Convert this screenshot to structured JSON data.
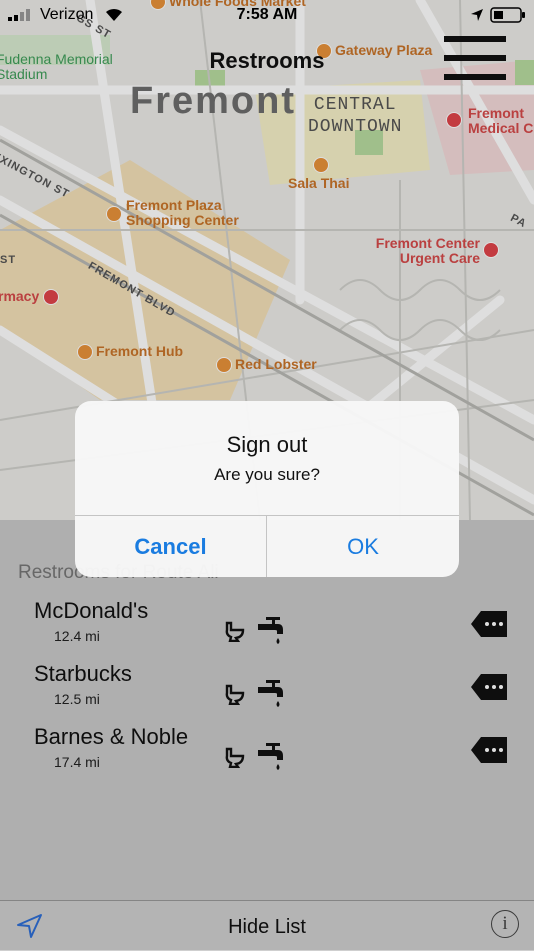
{
  "status": {
    "carrier": "Verizon",
    "time": "7:58 AM"
  },
  "header": {
    "title": "Restrooms"
  },
  "map": {
    "city": "Fremont",
    "district_line1": "CENTRAL",
    "district_line2": "DOWNTOWN",
    "poi": {
      "whole_foods": "Whole Foods Market",
      "gateway": "Gateway Plaza",
      "fremont_medical": "Fremont Medical C",
      "fudenna": "Fudenna Memorial Stadium",
      "sala_thai": "Sala Thai",
      "fremont_plaza": "Fremont Plaza Shopping Center",
      "urgent_care": "Fremont Center Urgent Care",
      "pharmacy": "rmacy",
      "fremont_hub": "Fremont Hub",
      "red_lobster": "Red Lobster"
    },
    "streets": {
      "lexington": "EXINGTON ST",
      "fremont_blvd": "FREMONT BLVD",
      "pa": "PA",
      "st": "ST",
      "st2": "GS ST"
    }
  },
  "alert": {
    "title": "Sign out",
    "message": "Are you sure?",
    "cancel": "Cancel",
    "ok": "OK"
  },
  "list": {
    "heading": "Restrooms for Route Ali",
    "items": [
      {
        "name": "McDonald's",
        "distance": "12.4 mi"
      },
      {
        "name": "Starbucks",
        "distance": "12.5 mi"
      },
      {
        "name": "Barnes & Noble",
        "distance": "17.4 mi"
      }
    ]
  },
  "bottom": {
    "hide_list": "Hide List",
    "info": "i"
  }
}
